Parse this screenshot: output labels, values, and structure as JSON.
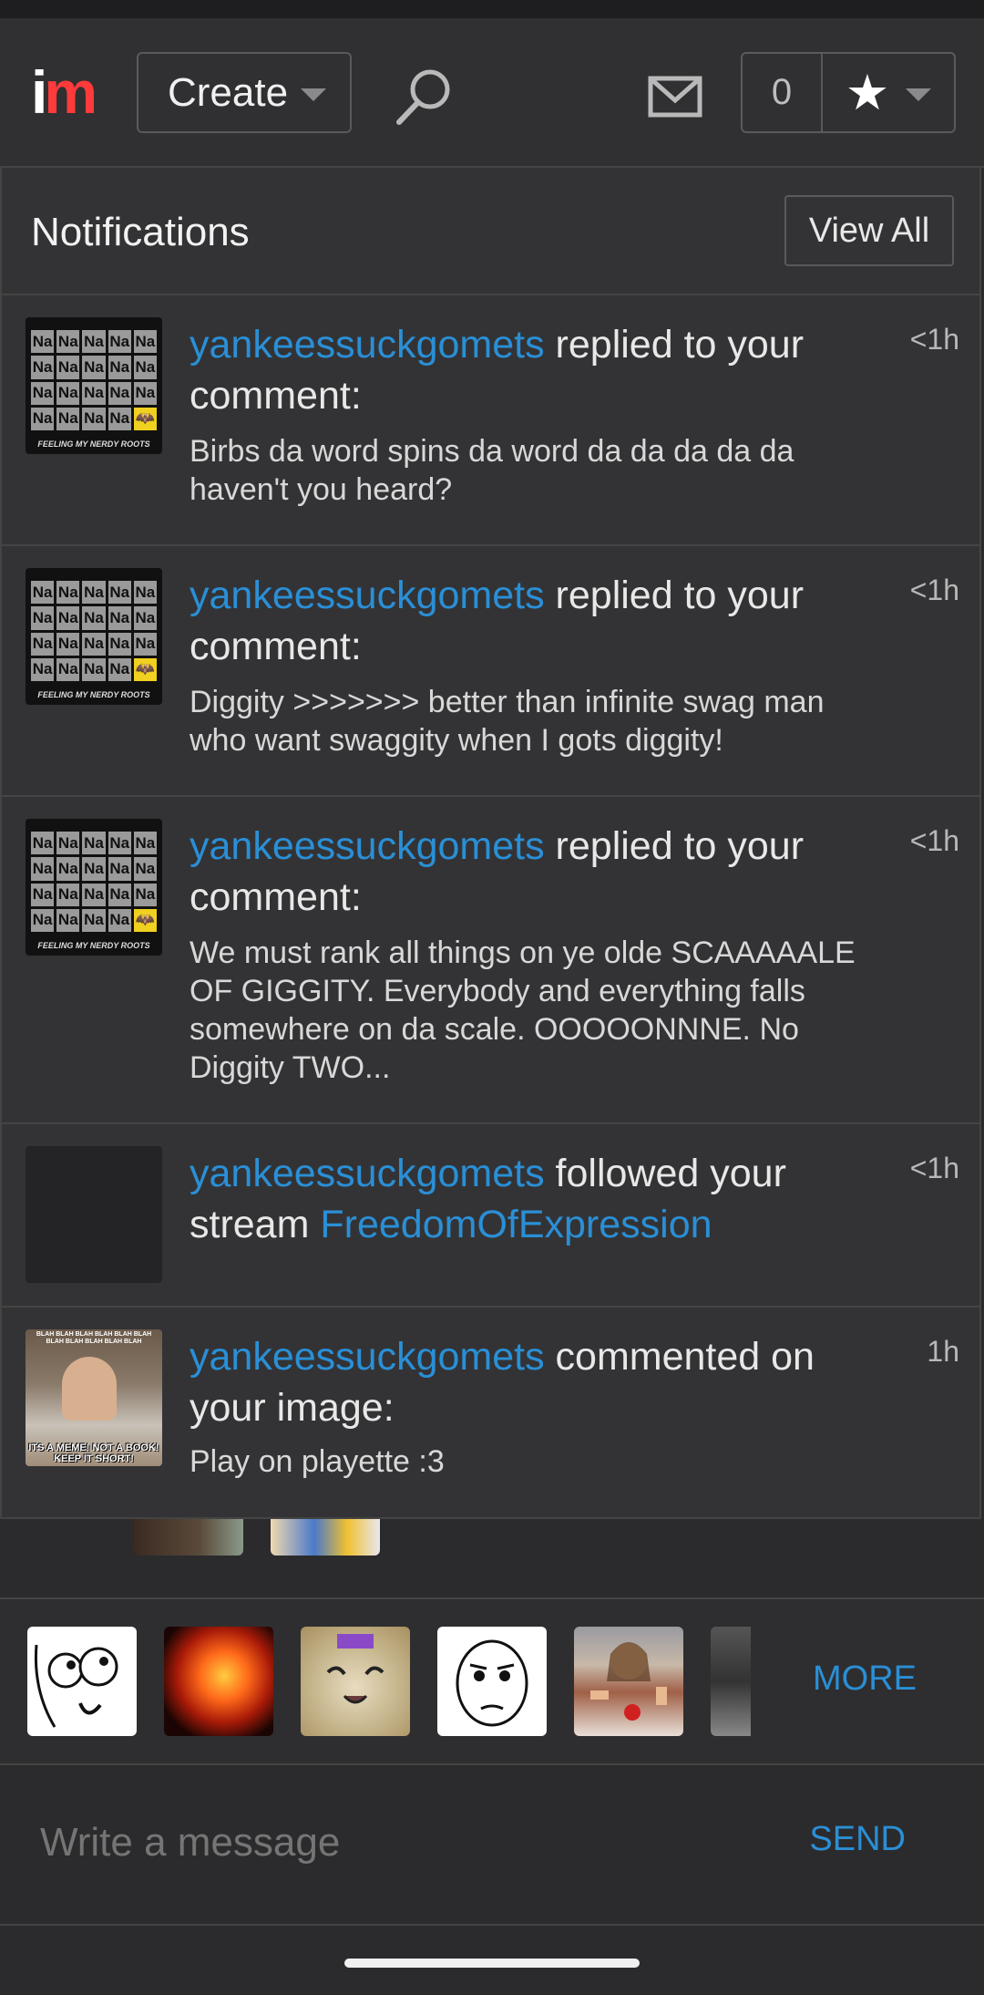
{
  "topbar": {
    "logo_i": "i",
    "logo_m": "m",
    "create_label": "Create",
    "score_count": "0",
    "star_glyph": "★"
  },
  "notifications": {
    "title": "Notifications",
    "view_all_label": "View All",
    "items": [
      {
        "user": "yankeessuckgomets",
        "action": " replied to your comment:",
        "body": "Birbs da word spins da word da da da da da haven't you heard?",
        "time": "<1h",
        "thumb": "periodic-na"
      },
      {
        "user": "yankeessuckgomets",
        "action": " replied to your comment:",
        "body": "Diggity >>>>>>> better than infinite swag man who want swaggity when I gots diggity!",
        "time": "<1h",
        "thumb": "periodic-na"
      },
      {
        "user": "yankeessuckgomets",
        "action": " replied to your comment:",
        "body": "We must rank all things on ye olde SCAAAAALE OF GIGGITY. Everybody and everything falls somewhere on da scale. OOOOONNNE. No Diggity TWO...",
        "time": "<1h",
        "thumb": "periodic-na"
      },
      {
        "user": "yankeessuckgomets",
        "action": " followed your stream ",
        "link": "FreedomOfExpression",
        "time": "<1h",
        "thumb": "blank"
      },
      {
        "user": "yankeessuckgomets",
        "action": " commented on your image:",
        "body": "Play on playette :3",
        "time": "1h",
        "thumb": "meme-chef"
      }
    ],
    "periodic": {
      "symbol": "Na",
      "caption": "FEELING MY NERDY ROOTS"
    },
    "meme": {
      "top_text": "BLAH BLAH BLAH BLAH BLAH BLAH BLAH BLAH BLAH BLAH BLAH",
      "bottom_text": "ITS A MEME! NOT A BOOK! KEEP IT SHORT!"
    }
  },
  "stickers": {
    "items": [
      "derp-face",
      "explosion",
      "happy-cat",
      "okay-face",
      "buddy-christ",
      "partial"
    ],
    "more_label": "MORE"
  },
  "composer": {
    "placeholder": "Write a message",
    "send_label": "SEND"
  },
  "colors": {
    "accent": "#2a8fd6",
    "logo_red": "#ff3a3a",
    "background": "#2b2b2d"
  }
}
